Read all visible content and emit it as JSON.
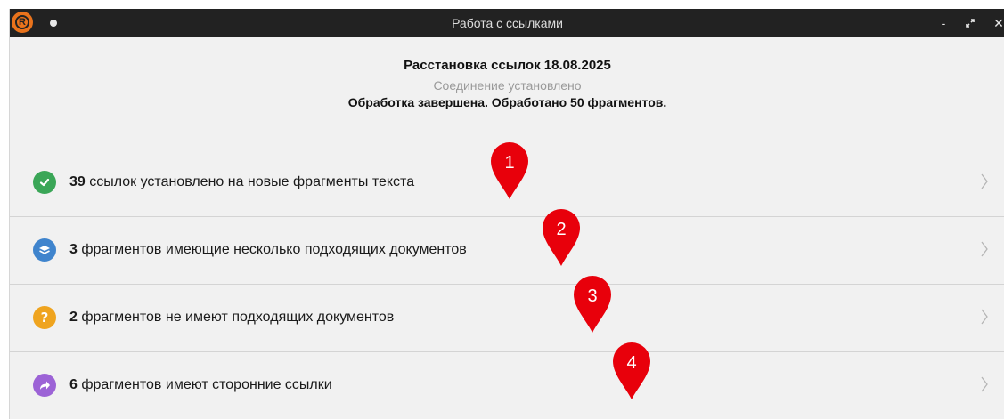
{
  "window": {
    "title": "Работа с ссылками",
    "controls": {
      "minimize": "-",
      "restore": "⤢",
      "close": "✕"
    }
  },
  "header": {
    "title": "Расстановка ссылок 18.08.2025",
    "status": "Соединение установлено",
    "result": "Обработка завершена. Обработано 50 фрагментов."
  },
  "items": [
    {
      "count": "39",
      "text": " ссылок установлено на новые фрагменты текста",
      "icon": "check-icon",
      "color": "#3aa657",
      "glyph": "✓"
    },
    {
      "count": "3",
      "text": " фрагментов имеющие несколько подходящих документов",
      "icon": "layers-icon",
      "color": "#3f84cd",
      "glyph": ""
    },
    {
      "count": "2",
      "text": " фрагментов не имеют подходящих документов",
      "icon": "question-icon",
      "color": "#efa41f",
      "glyph": "?"
    },
    {
      "count": "6",
      "text": " фрагментов имеют сторонние ссылки",
      "icon": "share-arrow-icon",
      "color": "#9c63d6",
      "glyph": "➦"
    }
  ],
  "markers": [
    {
      "label": "1",
      "color": "#e8000b"
    },
    {
      "label": "2",
      "color": "#e8000b"
    },
    {
      "label": "3",
      "color": "#e8000b"
    },
    {
      "label": "4",
      "color": "#e8000b"
    }
  ]
}
